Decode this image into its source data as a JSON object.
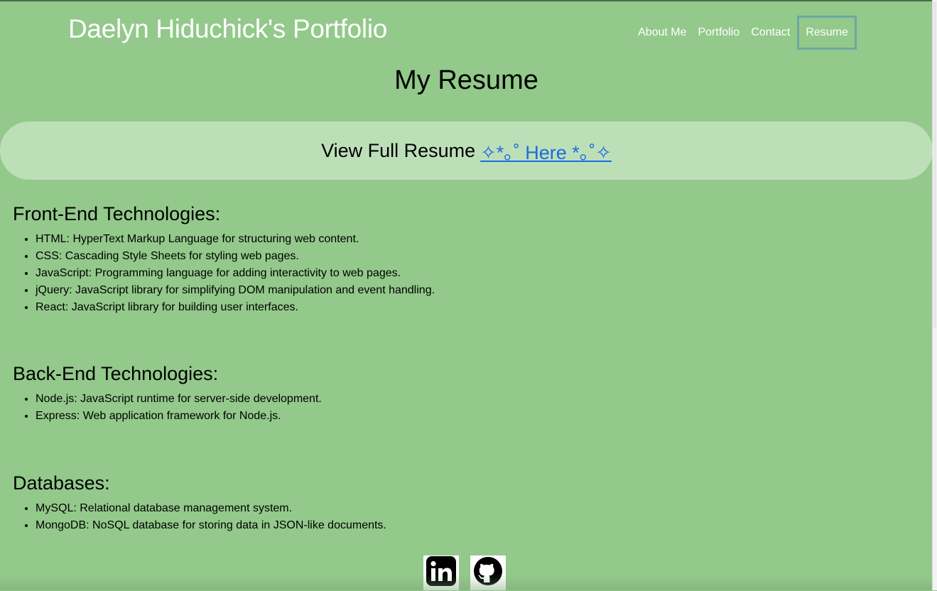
{
  "header": {
    "site_title": "Daelyn Hiduchick's Portfolio",
    "nav": [
      {
        "label": "About Me",
        "active": false
      },
      {
        "label": "Portfolio",
        "active": false
      },
      {
        "label": "Contact",
        "active": false
      },
      {
        "label": "Resume",
        "active": true
      }
    ]
  },
  "main": {
    "heading": "My Resume",
    "resume_banner": {
      "text": "View Full Resume",
      "link_label": "✧*｡˚ Here *｡˚✧"
    },
    "sections": [
      {
        "title": "Front-End Technologies:",
        "items": [
          "HTML: HyperText Markup Language for structuring web content.",
          "CSS: Cascading Style Sheets for styling web pages.",
          "JavaScript: Programming language for adding interactivity to web pages.",
          "jQuery: JavaScript library for simplifying DOM manipulation and event handling.",
          "React: JavaScript library for building user interfaces."
        ]
      },
      {
        "title": "Back-End Technologies:",
        "items": [
          "Node.js: JavaScript runtime for server-side development.",
          "Express: Web application framework for Node.js."
        ]
      },
      {
        "title": "Databases:",
        "items": [
          "MySQL: Relational database management system.",
          "MongoDB: NoSQL database for storing data in JSON-like documents."
        ]
      }
    ]
  },
  "footer": {
    "icons": [
      "linkedin-icon",
      "github-icon"
    ]
  },
  "colors": {
    "background": "#93c98b",
    "banner": "#bddfb8",
    "link": "#1a6de0",
    "nav_text": "#ffffff",
    "active_border": "#6ea7a2"
  }
}
